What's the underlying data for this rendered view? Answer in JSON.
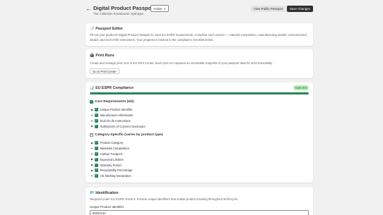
{
  "header": {
    "back_icon": "arrow-left-icon",
    "title": "Digital Product Passport",
    "status": "Active",
    "subtitle": "The Collection Snowboard: Hydrogen",
    "view_public_label": "View Public Passport",
    "save_label": "Save Changes"
  },
  "passport_editor": {
    "icon": "memo-icon",
    "title": "Passport Editor",
    "body": "Fill out your product's Digital Product Passport to meet EU ESPR requirements. Complete each section — material composition, manufacturing details, environmental impact, and end-of-life instructions. Your progress is tracked in the compliance checklist below."
  },
  "print_runs": {
    "icon": "printer-icon",
    "title": "Print Runs",
    "body": "Create and manage print runs in the Print Center. Each print run captures an immutable snapshot of your passport data for strict traceability.",
    "button_label": "Go to Print Center"
  },
  "compliance": {
    "icon": "bar-chart-icon",
    "title": "EU ESPR Compliance",
    "badge": "Core 4/4",
    "progress_fraction": 1.0,
    "core_heading": "Core Requirements (4/4)",
    "core_items": [
      "Unique Product Identifier",
      "Manufacturer Information",
      "End-of-Life Instructions",
      "Substances of Concern Disclosure"
    ],
    "category_heading": "Category-Specific (varies by product type)",
    "category_items": [
      "Product Category",
      "Materials Composition",
      "Carbon Footprint",
      "Expected Lifetime",
      "Warranty Period",
      "Recyclability Percentage",
      "CE Marking Declaration"
    ]
  },
  "identification": {
    "icon": "id-card-icon",
    "title": "Identification",
    "body": "Required under EU ESPR Article 9. Provide unique identifiers that enable product tracking throughout its lifecycle.",
    "field_label": "Unique Product Identifier",
    "field_value": "8000213A"
  },
  "colors": {
    "accent": "#29845a",
    "primary_button": "#303030",
    "badge_bg": "#b4f0b4",
    "page_bg": "#f1f1f1"
  }
}
